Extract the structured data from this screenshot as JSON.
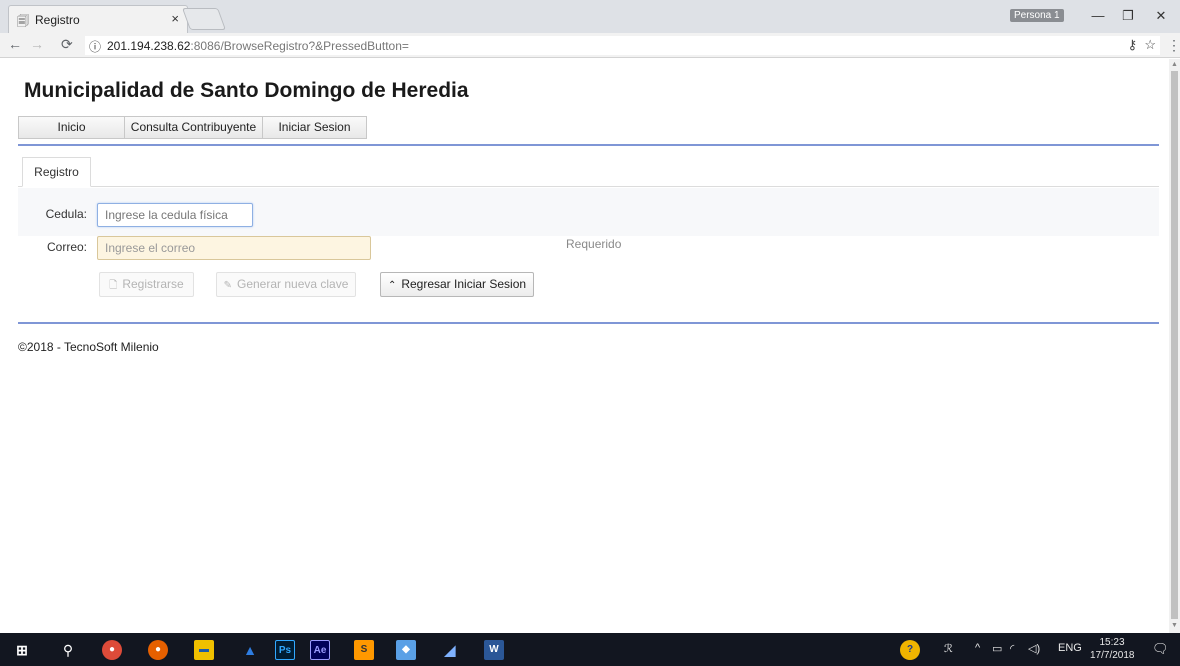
{
  "browser": {
    "tab_title": "Registro",
    "tab_close": "×",
    "profile": "Persona 1",
    "url_host": "201.194.238.62",
    "url_rest": ":8086/BrowseRegistro?&PressedButton=",
    "info": "ⓘ",
    "minimize": "—",
    "restore": "❐",
    "close": "✕"
  },
  "page": {
    "title": "Municipalidad de Santo Domingo de Heredia",
    "menu": [
      {
        "label": "Inicio"
      },
      {
        "label": "Consulta Contribuyente"
      },
      {
        "label": "Iniciar Sesion"
      }
    ],
    "form_tab": "Registro",
    "cedula_label": "Cedula:",
    "cedula_placeholder": "Ingrese la cedula física",
    "correo_label": "Correo:",
    "correo_placeholder": "Ingrese el correo",
    "required_text": "Requerido",
    "buttons": {
      "registrarse": "Registrarse",
      "generar": "Generar nueva clave",
      "regresar": "Regresar Iniciar Sesion"
    },
    "footer": "©2018 - TecnoSoft Milenio"
  },
  "taskbar": {
    "lang": "ENG",
    "time": "15:23",
    "date": "17/7/2018"
  },
  "colors": {
    "accent_rule": "#7f96d6",
    "input_focus": "#8fb0e3",
    "input_required_bg": "#fdf5e1"
  },
  "icons": [
    "page-icon",
    "back-arrow-icon",
    "forward-arrow-icon",
    "reload-icon",
    "info-icon",
    "key-icon",
    "star-icon",
    "menu-dots-icon",
    "windows-start-icon",
    "search-icon"
  ]
}
